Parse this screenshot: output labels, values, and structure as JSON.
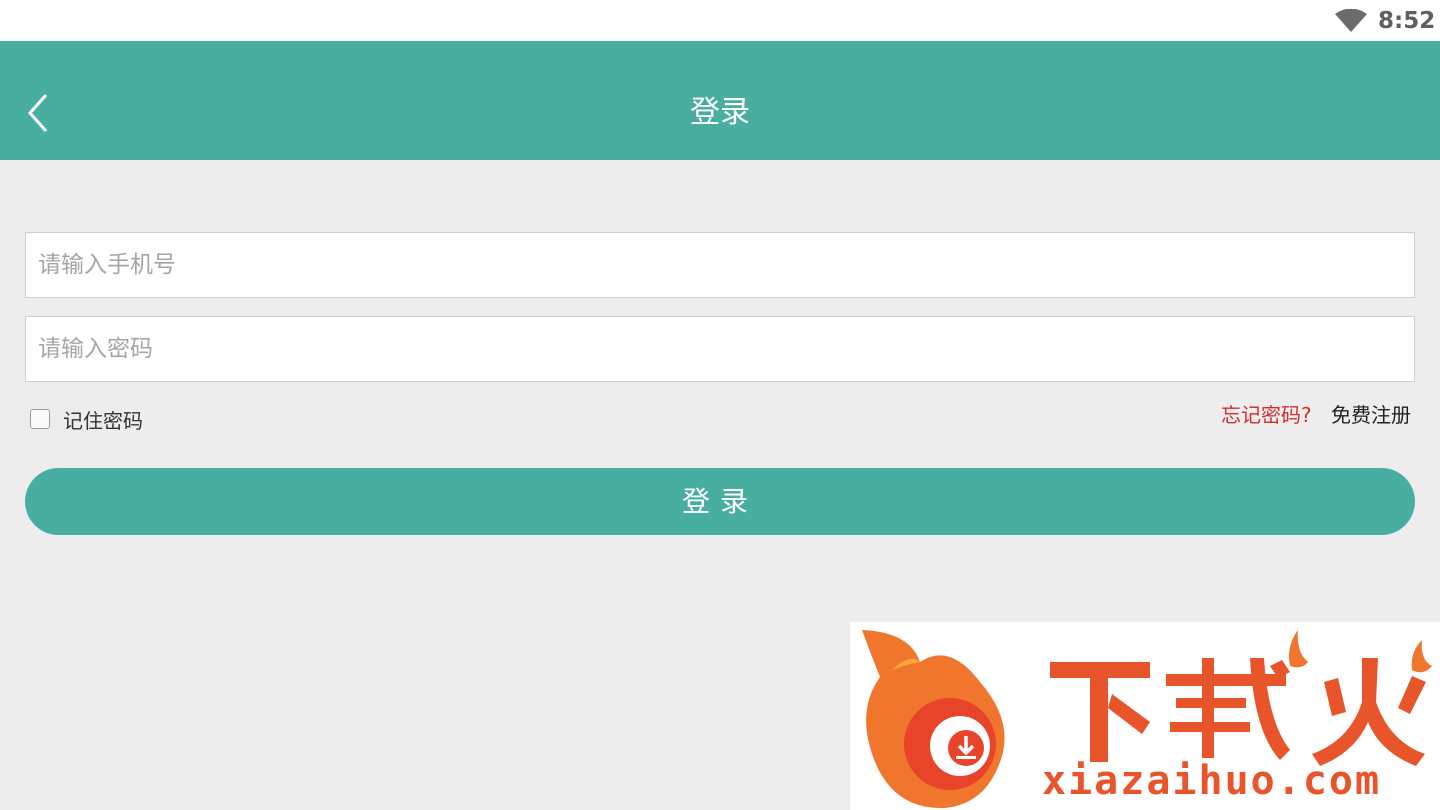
{
  "status_bar": {
    "time": "8:52",
    "wifi_icon": "wifi-icon"
  },
  "header": {
    "title": "登录",
    "back_icon": "chevron-left-icon"
  },
  "form": {
    "phone_placeholder": "请输入手机号",
    "password_placeholder": "请输入密码",
    "remember_label": "记住密码",
    "forgot_label": "忘记密码?",
    "register_label": "免费注册",
    "login_label": "登录"
  },
  "watermark": {
    "brand": "下载火",
    "url": "xiazaihuo.com"
  },
  "colors": {
    "primary": "#48afa0",
    "background": "#ededed",
    "link_red": "#d72d2d",
    "watermark_orange": "#e8552b"
  }
}
